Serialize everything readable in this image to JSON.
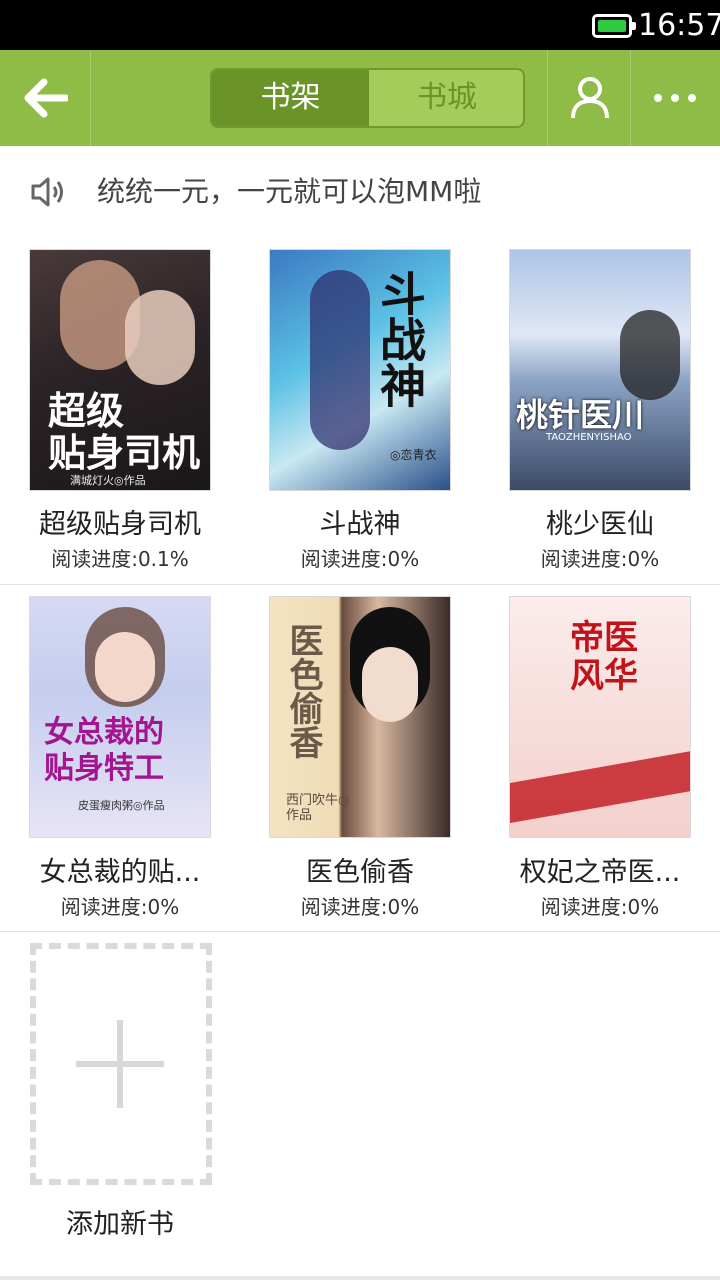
{
  "status_bar": {
    "time": "16:57",
    "battery_level": 1.0
  },
  "toolbar": {
    "back_icon": "back-arrow-icon",
    "tabs": [
      {
        "label": "书架",
        "active": true
      },
      {
        "label": "书城",
        "active": false
      }
    ],
    "user_icon": "user-icon",
    "more_icon": "more-icon",
    "color": "#8fbc46"
  },
  "notice": {
    "icon": "speaker-icon",
    "text": "统统一元，一元就可以泡MM啦"
  },
  "books": [
    {
      "title": "超级贴身司机",
      "progress": "阅读进度:0.1%",
      "cover_text": "超级\n贴身司机",
      "cover_author": "满城灯火◎作品"
    },
    {
      "title": "斗战神",
      "progress": "阅读进度:0%",
      "cover_text": "斗战神",
      "cover_author": "◎恋青衣"
    },
    {
      "title": "桃少医仙",
      "progress": "阅读进度:0%",
      "cover_text": "桃针医川",
      "cover_author": "TAOZHENYISHAO"
    },
    {
      "title": "女总裁的贴...",
      "progress": "阅读进度:0%",
      "cover_text": "女总裁的\n贴身特工",
      "cover_author": "皮蛋瘦肉粥◎作品"
    },
    {
      "title": "医色偷香",
      "progress": "阅读进度:0%",
      "cover_text": "医色偷香",
      "cover_author": "西门吹牛◎作品"
    },
    {
      "title": "权妃之帝医...",
      "progress": "阅读进度:0%",
      "cover_text": "帝医风华",
      "cover_author": ""
    }
  ],
  "add_book": {
    "label": "添加新书",
    "icon": "plus-icon"
  }
}
